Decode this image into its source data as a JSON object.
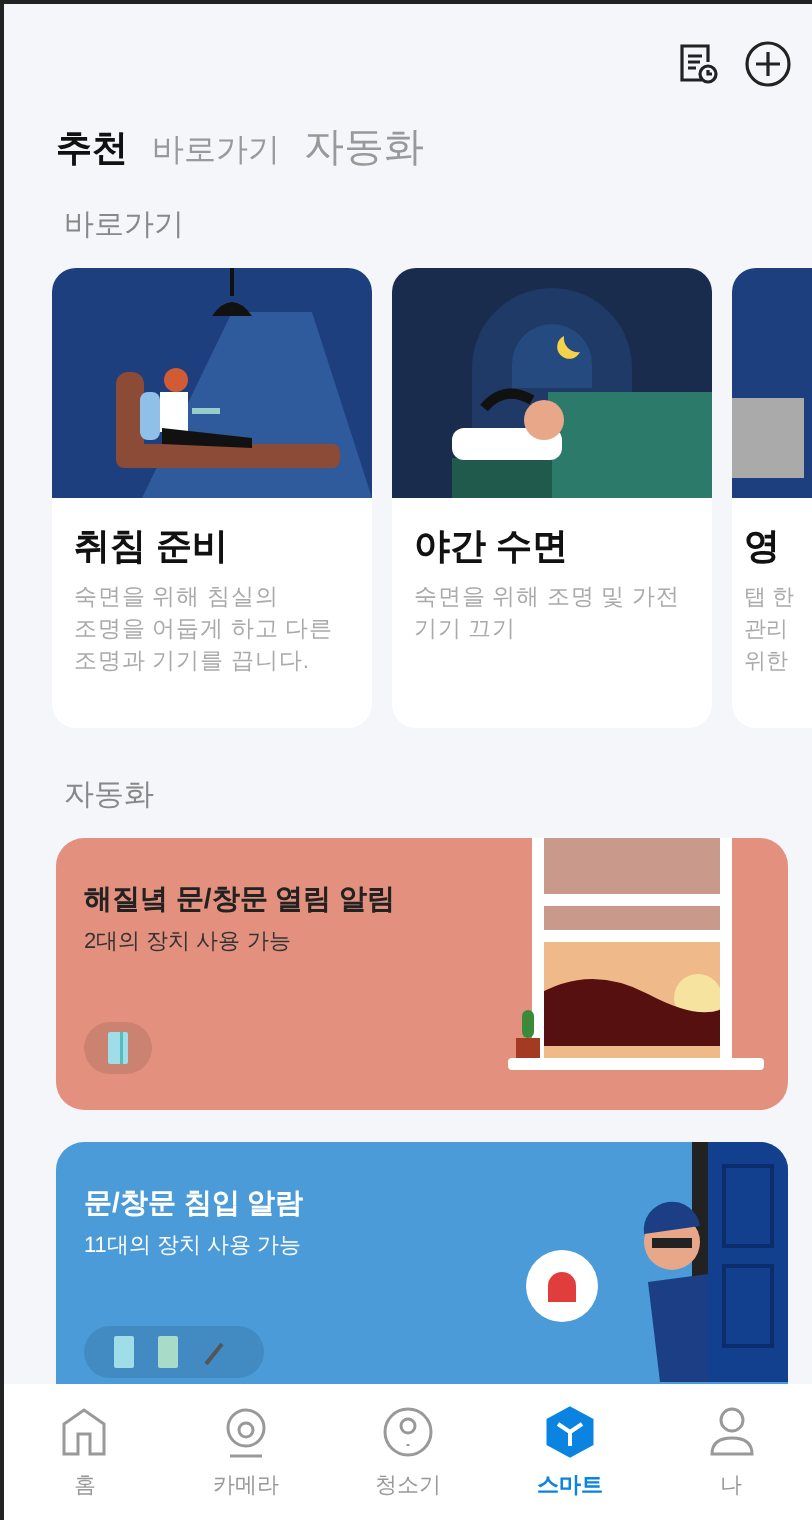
{
  "tabs": [
    {
      "label": "추천",
      "selected": true
    },
    {
      "label": "바로가기",
      "selected": false
    },
    {
      "label": "자동화",
      "selected": false
    }
  ],
  "shortcuts": {
    "heading": "바로가기",
    "cards": [
      {
        "title": "취침 준비",
        "desc_lines": [
          "숙면을 위해 침실의",
          "조명을 어둡게 하고 다른",
          "조명과 기기를 끕니다."
        ]
      },
      {
        "title": "야간 수면",
        "desc_lines": [
          "숙면을 위해 조명 및 가전",
          "기기 끄기"
        ]
      },
      {
        "title": "영",
        "desc_lines": [
          "탭 한",
          "관리",
          "위한"
        ]
      }
    ]
  },
  "automation": {
    "heading": "자동화",
    "cards": [
      {
        "title": "해질녘 문/창문 열림 알림",
        "subtitle": "2대의 장치 사용 가능",
        "color": "#e3917e"
      },
      {
        "title": "문/창문 침입 알람",
        "subtitle": "11대의 장치 사용 가능",
        "color": "#4a9bd8"
      }
    ]
  },
  "nav": [
    {
      "label": "홈",
      "selected": false
    },
    {
      "label": "카메라",
      "selected": false
    },
    {
      "label": "청소기",
      "selected": false
    },
    {
      "label": "스마트",
      "selected": true
    },
    {
      "label": "나",
      "selected": false
    }
  ]
}
